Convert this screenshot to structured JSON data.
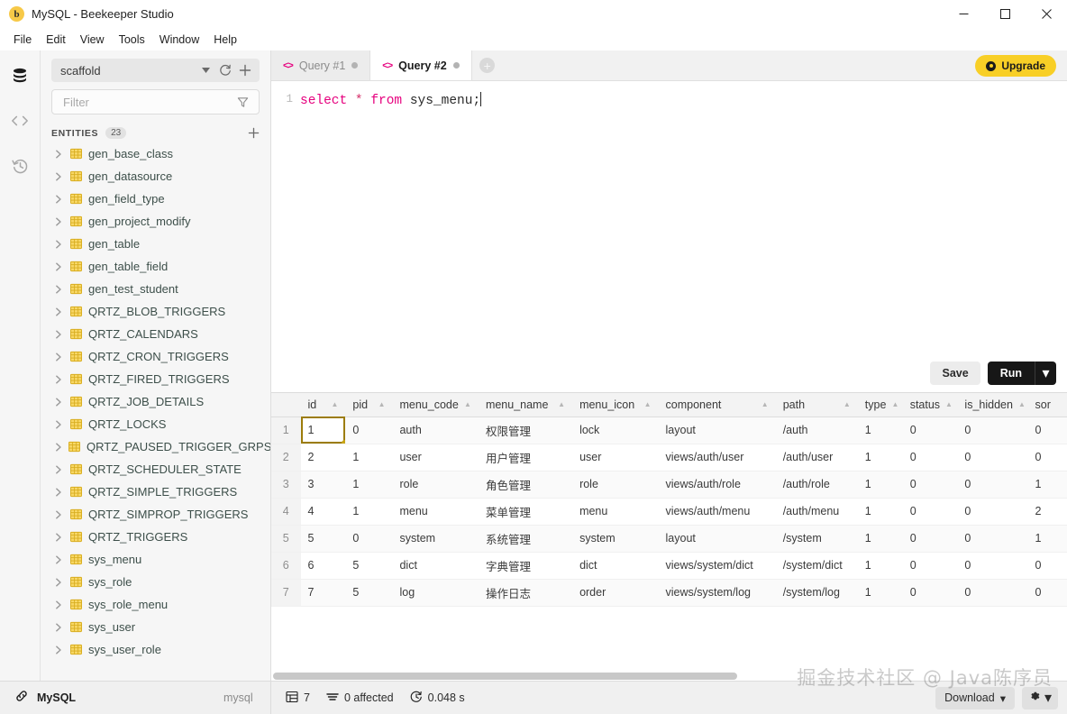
{
  "window": {
    "title": "MySQL - Beekeeper Studio",
    "logo_letter": "b",
    "minimize_label": "—",
    "maximize_label": "□",
    "close_label": "✕"
  },
  "menubar": {
    "items": [
      "File",
      "Edit",
      "View",
      "Tools",
      "Window",
      "Help"
    ]
  },
  "rail": {
    "items": [
      {
        "name": "database-icon",
        "label": "Database"
      },
      {
        "name": "code-icon",
        "label": "Query"
      },
      {
        "name": "history-icon",
        "label": "History"
      }
    ]
  },
  "sidebar": {
    "database": "scaffold",
    "refresh_label": "⟳",
    "add_label": "+",
    "filter_placeholder": "Filter",
    "entities_label": "ENTITIES",
    "entities_count": "23",
    "entities_add_label": "+",
    "entities": [
      "gen_base_class",
      "gen_datasource",
      "gen_field_type",
      "gen_project_modify",
      "gen_table",
      "gen_table_field",
      "gen_test_student",
      "QRTZ_BLOB_TRIGGERS",
      "QRTZ_CALENDARS",
      "QRTZ_CRON_TRIGGERS",
      "QRTZ_FIRED_TRIGGERS",
      "QRTZ_JOB_DETAILS",
      "QRTZ_LOCKS",
      "QRTZ_PAUSED_TRIGGER_GRPS",
      "QRTZ_SCHEDULER_STATE",
      "QRTZ_SIMPLE_TRIGGERS",
      "QRTZ_SIMPROP_TRIGGERS",
      "QRTZ_TRIGGERS",
      "sys_menu",
      "sys_role",
      "sys_role_menu",
      "sys_user",
      "sys_user_role"
    ]
  },
  "tabs": [
    {
      "label": "Query #1",
      "active": false
    },
    {
      "label": "Query #2",
      "active": true
    }
  ],
  "new_tab_label": "+",
  "upgrade": {
    "label": "Upgrade"
  },
  "editor": {
    "line_number": "1",
    "sql_keyword_1": "select",
    "sql_star": "*",
    "sql_keyword_2": "from",
    "sql_table": " sys_menu;"
  },
  "actions": {
    "save_label": "Save",
    "run_label": "Run",
    "run_caret_label": "▾"
  },
  "results": {
    "columns": [
      "id",
      "pid",
      "menu_code",
      "menu_name",
      "menu_icon",
      "component",
      "path",
      "type",
      "status",
      "is_hidden",
      "sor"
    ],
    "rows": [
      {
        "num": "1",
        "id": "1",
        "pid": "0",
        "menu_code": "auth",
        "menu_name": "权限管理",
        "menu_icon": "lock",
        "component": "layout",
        "path": "/auth",
        "type": "1",
        "status": "0",
        "is_hidden": "0",
        "sor": "0"
      },
      {
        "num": "2",
        "id": "2",
        "pid": "1",
        "menu_code": "user",
        "menu_name": "用户管理",
        "menu_icon": "user",
        "component": "views/auth/user",
        "path": "/auth/user",
        "type": "1",
        "status": "0",
        "is_hidden": "0",
        "sor": "0"
      },
      {
        "num": "3",
        "id": "3",
        "pid": "1",
        "menu_code": "role",
        "menu_name": "角色管理",
        "menu_icon": "role",
        "component": "views/auth/role",
        "path": "/auth/role",
        "type": "1",
        "status": "0",
        "is_hidden": "0",
        "sor": "1"
      },
      {
        "num": "4",
        "id": "4",
        "pid": "1",
        "menu_code": "menu",
        "menu_name": "菜单管理",
        "menu_icon": "menu",
        "component": "views/auth/menu",
        "path": "/auth/menu",
        "type": "1",
        "status": "0",
        "is_hidden": "0",
        "sor": "2"
      },
      {
        "num": "5",
        "id": "5",
        "pid": "0",
        "menu_code": "system",
        "menu_name": "系统管理",
        "menu_icon": "system",
        "component": "layout",
        "path": "/system",
        "type": "1",
        "status": "0",
        "is_hidden": "0",
        "sor": "1"
      },
      {
        "num": "6",
        "id": "6",
        "pid": "5",
        "menu_code": "dict",
        "menu_name": "字典管理",
        "menu_icon": "dict",
        "component": "views/system/dict",
        "path": "/system/dict",
        "type": "1",
        "status": "0",
        "is_hidden": "0",
        "sor": "0"
      },
      {
        "num": "7",
        "id": "7",
        "pid": "5",
        "menu_code": "log",
        "menu_name": "操作日志",
        "menu_icon": "order",
        "component": "views/system/log",
        "path": "/system/log",
        "type": "1",
        "status": "0",
        "is_hidden": "0",
        "sor": "0"
      }
    ]
  },
  "statusbar": {
    "connection": "MySQL",
    "engine": "mysql",
    "row_count": "7",
    "affected": "0 affected",
    "duration": "0.048 s",
    "download_label": "Download",
    "download_caret": "▾",
    "gear_caret": "▾"
  },
  "watermark": "掘金技术社区 @ Java陈序员",
  "colors": {
    "accent_pink": "#e6007e",
    "upgrade_yellow": "#f8cf26",
    "run_black": "#171717",
    "selection_gold": "#9c7c0b",
    "table_icon_yellow": "#f5c842"
  }
}
